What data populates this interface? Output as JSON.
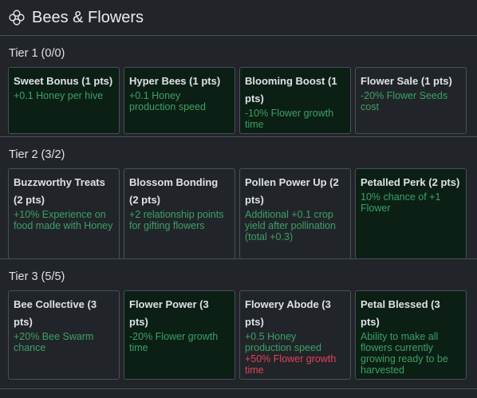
{
  "header": {
    "title": "Bees & Flowers",
    "icon": "flower-icon"
  },
  "colors": {
    "owned_bg": "#0b1f14",
    "desc_green": "#3da066",
    "warn_red": "#e4405a",
    "border": "#495057"
  },
  "tiers": [
    {
      "label": "Tier 1 (0/0)",
      "cards": [
        {
          "name": "Sweet Bonus (1 pts)",
          "desc": "+0.1 Honey per hive",
          "owned": true
        },
        {
          "name": "Hyper Bees (1 pts)",
          "desc": "+0.1 Honey production speed",
          "owned": true
        },
        {
          "name": "Blooming Boost (1 pts)",
          "desc": "-10% Flower growth time",
          "owned": true
        },
        {
          "name": "Flower Sale (1 pts)",
          "desc": "-20% Flower Seeds cost",
          "owned": false
        }
      ]
    },
    {
      "label": "Tier 2 (3/2)",
      "cards": [
        {
          "name": "Buzzworthy Treats (2 pts)",
          "desc": "+10% Experience on food made with Honey",
          "owned": false
        },
        {
          "name": "Blossom Bonding (2 pts)",
          "desc": "+2 relationship points for gifting flowers",
          "owned": false
        },
        {
          "name": "Pollen Power Up (2 pts)",
          "desc": "Additional +0.1 crop yield after pollination (total +0.3)",
          "owned": false
        },
        {
          "name": "Petalled Perk (2 pts)",
          "desc": "10% chance of +1 Flower",
          "owned": true
        }
      ]
    },
    {
      "label": "Tier 3 (5/5)",
      "cards": [
        {
          "name": "Bee Collective (3 pts)",
          "desc": "+20% Bee Swarm chance",
          "owned": false
        },
        {
          "name": "Flower Power (3 pts)",
          "desc": "-20% Flower growth time",
          "owned": true
        },
        {
          "name": "Flowery Abode (3 pts)",
          "desc": "+0.5 Honey production speed",
          "warning": "+50% Flower growth time",
          "owned": false
        },
        {
          "name": "Petal Blessed (3 pts)",
          "desc": "Ability to make all flowers currently growing ready to be harvested",
          "owned": true
        }
      ]
    }
  ]
}
